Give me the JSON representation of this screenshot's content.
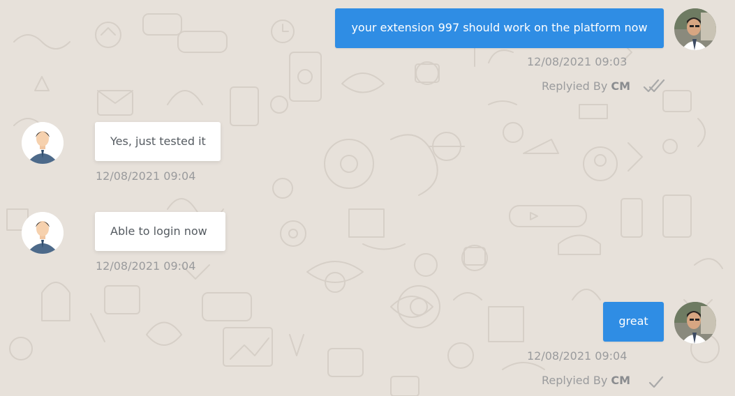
{
  "messages": [
    {
      "direction": "outgoing",
      "text": "your extension 997 should work on the platform now",
      "timestamp": "12/08/2021 09:03",
      "replied_prefix": "Replyied By",
      "replied_by": "CM",
      "status": "read-double-check"
    },
    {
      "direction": "incoming",
      "text": "Yes, just tested it",
      "timestamp": "12/08/2021 09:04"
    },
    {
      "direction": "incoming",
      "text": "Able to login now",
      "timestamp": "12/08/2021 09:04"
    },
    {
      "direction": "outgoing",
      "text": "great",
      "timestamp": "12/08/2021 09:04",
      "replied_prefix": "Replyied By",
      "replied_by": "CM",
      "status": "sent-single-check"
    }
  ],
  "colors": {
    "background": "#e7e1da",
    "outgoing_bubble": "#2f8de4",
    "incoming_bubble": "#ffffff",
    "meta_text": "#9a9b9d"
  },
  "icons": {
    "agent_avatar": "agent-photo-avatar",
    "customer_avatar": "businessman-avatar",
    "read_receipt": "double-check-icon",
    "sent_receipt": "check-icon"
  }
}
